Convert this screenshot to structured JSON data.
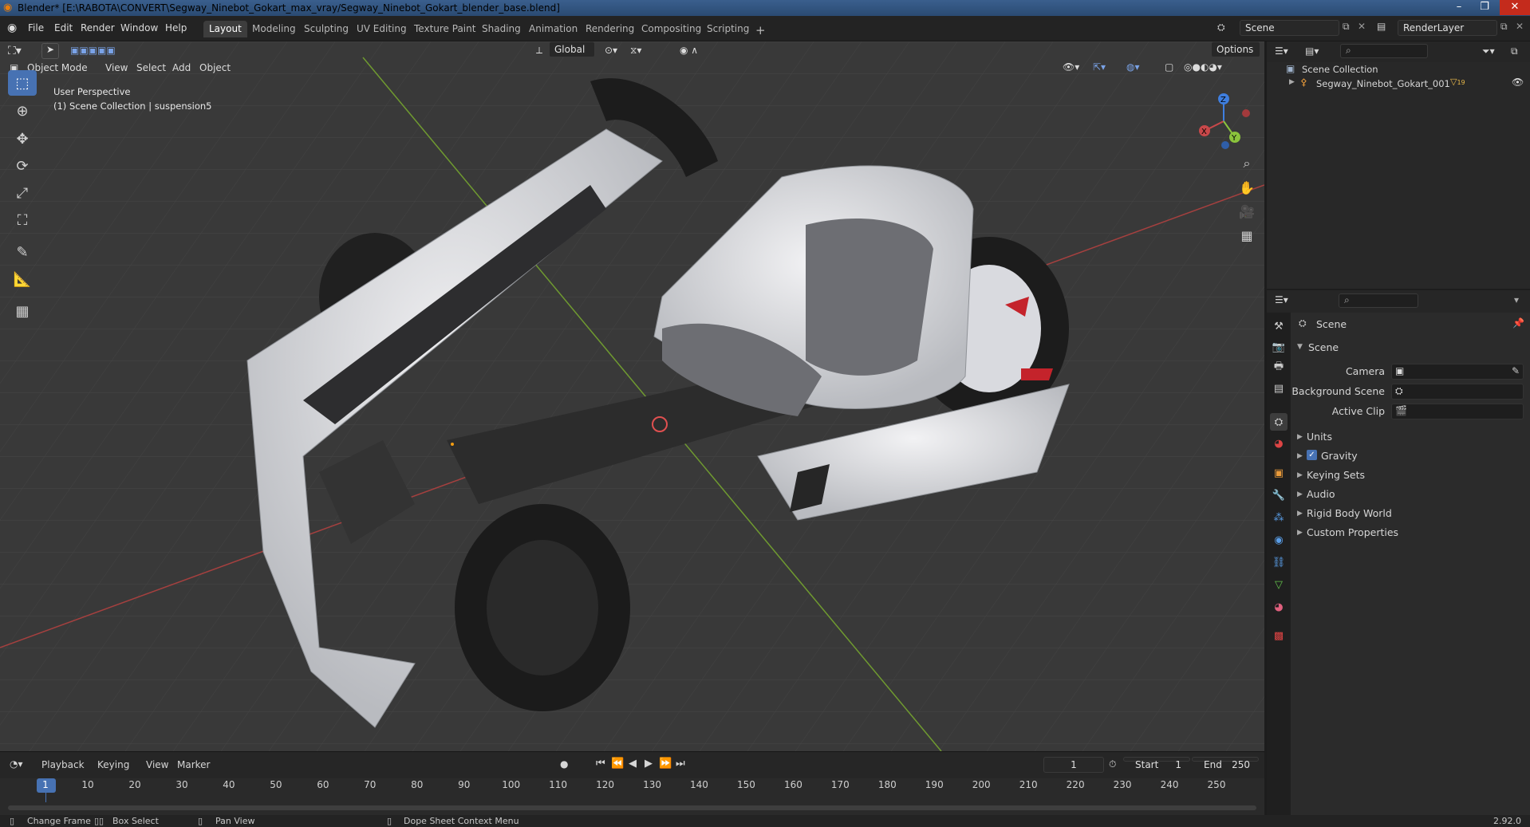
{
  "window": {
    "title": "Blender* [E:\\RABOTA\\CONVERT\\Segway_Ninebot_Gokart_max_vray/Segway_Ninebot_Gokart_blender_base.blend]"
  },
  "menu": [
    "File",
    "Edit",
    "Render",
    "Window",
    "Help"
  ],
  "workspaces": [
    "Layout",
    "Modeling",
    "Sculpting",
    "UV Editing",
    "Texture Paint",
    "Shading",
    "Animation",
    "Rendering",
    "Compositing",
    "Scripting"
  ],
  "active_workspace": "Layout",
  "scene_field": "Scene",
  "renderlayer_field": "RenderLayer",
  "viewport": {
    "mode": "Object Mode",
    "header_menus": [
      "View",
      "Select",
      "Add",
      "Object"
    ],
    "transform_orientation": "Global",
    "options_label": "Options",
    "overlay_line1": "User Perspective",
    "overlay_line2": "(1) Scene Collection | suspension5",
    "gizmo_axes": {
      "x": "X",
      "y": "Y",
      "z": "Z"
    }
  },
  "outliner": {
    "root": "Scene Collection",
    "items": [
      {
        "name": "Segway_Ninebot_Gokart_001",
        "badge": "19"
      }
    ]
  },
  "properties": {
    "header": "Scene",
    "panel": "Scene",
    "fields": [
      {
        "label": "Camera"
      },
      {
        "label": "Background Scene"
      },
      {
        "label": "Active Clip"
      }
    ],
    "subpanels": [
      "Units",
      "Gravity",
      "Keying Sets",
      "Audio",
      "Rigid Body World",
      "Custom Properties"
    ]
  },
  "timeline": {
    "menus": [
      "Playback",
      "Keying",
      "View",
      "Marker"
    ],
    "current_frame": "1",
    "start_label": "Start",
    "start_value": "1",
    "end_label": "End",
    "end_value": "250",
    "ticks": [
      "1",
      "10",
      "20",
      "30",
      "40",
      "50",
      "60",
      "70",
      "80",
      "90",
      "100",
      "110",
      "120",
      "130",
      "140",
      "150",
      "160",
      "170",
      "180",
      "190",
      "200",
      "210",
      "220",
      "230",
      "240",
      "250"
    ]
  },
  "statusbar": {
    "items": [
      "Change Frame",
      "Box Select",
      "Pan View",
      "Dope Sheet Context Menu"
    ],
    "version": "2.92.0"
  },
  "colors": {
    "accent": "#4772b3",
    "x_axis": "#c8484a",
    "y_axis": "#8bc43c",
    "z_axis": "#3f7fe0"
  }
}
